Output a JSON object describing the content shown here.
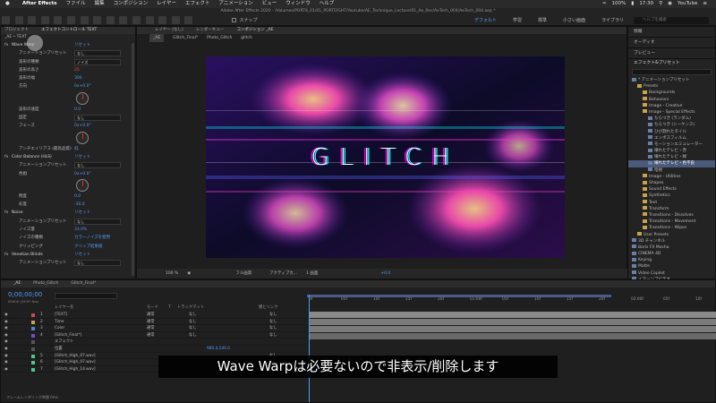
{
  "menubar": {
    "app_name": "After Effects",
    "items": [
      "ファイル",
      "編集",
      "コンポジション",
      "レイヤー",
      "エフェクト",
      "アニメーション",
      "ビュー",
      "ウィンドウ",
      "ヘルプ"
    ],
    "status": {
      "battery": "100%",
      "time": "17:30",
      "user": "YouTube"
    }
  },
  "titlebar": {
    "text": "Adobe After Effects 2020 - /Volumes/PORT8_01/01_PORTEIGHT/Youtube/AE_Technique_Lecture/01_Ae_Rec/AeTech_004/AeTech_004.aep *"
  },
  "toolbar": {
    "snap_label": "スナップ",
    "workspaces": [
      "デフォルト",
      "学習",
      "標準",
      "小さい画面",
      "ライブラリ"
    ],
    "active_workspace": "デフォルト",
    "help_search_placeholder": "ヘルプを検索"
  },
  "effect_controls": {
    "tabs": [
      "プロジェクト",
      "エフェクトコントロール TEXT",
      "レイヤー (なし)",
      "レンダーキュー",
      "コンポジション _AE"
    ],
    "breadcrumb": "_AE • TEXT",
    "rows": [
      {
        "label": "Wave Warp",
        "value": "リセット",
        "kind": "fx"
      },
      {
        "label": "アニメーションプリセット",
        "dropdown": "なし"
      },
      {
        "label": "波形の種類",
        "dropdown": "ノイズ"
      },
      {
        "label": "波形の高さ",
        "value": "25",
        "red": true
      },
      {
        "label": "波形の幅",
        "value": "300"
      },
      {
        "label": "方向",
        "value": "0x+0.0°"
      },
      {
        "label": "",
        "dial": true
      },
      {
        "label": "波形の速度",
        "value": "0.0"
      },
      {
        "label": "固定",
        "dropdown": "なし"
      },
      {
        "label": "フェーズ",
        "value": "0x+0.0°"
      },
      {
        "label": "",
        "dial": true
      },
      {
        "label": "アンチエイリアス (最高品質)",
        "value": "低"
      },
      {
        "label": "Color Balance (HLS)",
        "value": "リセット",
        "kind": "fx"
      },
      {
        "label": "アニメーションプリセット",
        "dropdown": "なし"
      },
      {
        "label": "色相",
        "value": "0x+0.0°"
      },
      {
        "label": "",
        "dial": true
      },
      {
        "label": "明度",
        "value": "0.0"
      },
      {
        "label": "彩度",
        "value": "-30.0"
      },
      {
        "label": "Noise",
        "value": "リセット",
        "kind": "fx"
      },
      {
        "label": "アニメーションプリセット",
        "dropdown": "なし"
      },
      {
        "label": "ノイズ量",
        "value": "33.0%"
      },
      {
        "label": "ノイズの種類",
        "value": "カラーノイズを使用"
      },
      {
        "label": "クリッピング",
        "value": "クリップ結果値"
      },
      {
        "label": "Venetian Blinds",
        "value": "リセット",
        "kind": "fx"
      },
      {
        "label": "アニメーションプリセット",
        "dropdown": "なし"
      }
    ]
  },
  "viewer": {
    "tabs": [
      "_AE",
      "Glitch_Final*",
      "Photo_Glitch",
      "glitch"
    ],
    "title": "GLITCH",
    "footer": {
      "zoom": "100 %",
      "quality": "フル画質",
      "camera": "アクティブカ...",
      "views": "1 画面",
      "offset": "+0.0"
    }
  },
  "right_panel": {
    "sections": [
      "情報",
      "オーディオ",
      "プレビュー",
      "エフェクト&プリセット"
    ],
    "search_placeholder": "",
    "tree": [
      {
        "label": "* アニメーションプリセット",
        "indent": 0
      },
      {
        "label": "Presets",
        "indent": 1,
        "folder": true
      },
      {
        "label": "Backgrounds",
        "indent": 2,
        "folder": true
      },
      {
        "label": "Behaviors",
        "indent": 2,
        "folder": true
      },
      {
        "label": "Image - Creative",
        "indent": 2,
        "folder": true
      },
      {
        "label": "Image - Special Effects",
        "indent": 2,
        "folder": true
      },
      {
        "label": "ちらつき (ランダム)",
        "indent": 3
      },
      {
        "label": "ちらつき (シーケンス)",
        "indent": 3
      },
      {
        "label": "ひび割れたタイル",
        "indent": 3
      },
      {
        "label": "エンボスフィルム",
        "indent": 3
      },
      {
        "label": "モーションエミュレーター",
        "indent": 3
      },
      {
        "label": "壊れたテレビ・赤",
        "indent": 3
      },
      {
        "label": "壊れたテレビ・緑",
        "indent": 3
      },
      {
        "label": "壊れたテレビ・色不良",
        "indent": 3,
        "selected": true
      },
      {
        "label": "暗視",
        "indent": 3
      },
      {
        "label": "Image - Utilities",
        "indent": 2,
        "folder": true
      },
      {
        "label": "Shapes",
        "indent": 2,
        "folder": true
      },
      {
        "label": "Sound Effects",
        "indent": 2,
        "folder": true
      },
      {
        "label": "Synthetics",
        "indent": 2,
        "folder": true
      },
      {
        "label": "Text",
        "indent": 2,
        "folder": true
      },
      {
        "label": "Transform",
        "indent": 2,
        "folder": true
      },
      {
        "label": "Transitions - Dissolves",
        "indent": 2,
        "folder": true
      },
      {
        "label": "Transitions - Movement",
        "indent": 2,
        "folder": true
      },
      {
        "label": "Transitions - Wipes",
        "indent": 2,
        "folder": true
      },
      {
        "label": "User Presets",
        "indent": 1,
        "folder": true
      },
      {
        "label": "3D チャンネル",
        "indent": 0
      },
      {
        "label": "Boris FX Mocha",
        "indent": 0
      },
      {
        "label": "CINEMA 4D",
        "indent": 0
      },
      {
        "label": "Keying",
        "indent": 0
      },
      {
        "label": "Matte",
        "indent": 0
      },
      {
        "label": "Video Copilot",
        "indent": 0
      },
      {
        "label": "イマーシブビデオ",
        "indent": 0
      }
    ]
  },
  "timeline": {
    "tabs": [
      "_AE",
      "Photo_Glitch",
      "Glitch_Final*"
    ],
    "timecode": "0;00;00;00",
    "timecode_sub": "00000 (29.97 fps)",
    "columns": [
      "レイヤー名",
      "モード",
      "T",
      "トラックマット",
      "親とリンク"
    ],
    "ruler": [
      "0f",
      "05f",
      "10f",
      "15f",
      "20f",
      "01:00f",
      "05f",
      "10f",
      "15f",
      "20f",
      "02:00f",
      "05f",
      "10f"
    ],
    "layers": [
      {
        "num": "1",
        "name": "[TEXT]",
        "mode": "通常",
        "matte": "なし",
        "parent": "なし"
      },
      {
        "num": "2",
        "name": "Time",
        "mode": "通常",
        "matte": "なし",
        "parent": "なし"
      },
      {
        "num": "3",
        "name": "Color",
        "mode": "通常",
        "matte": "なし",
        "parent": "なし"
      },
      {
        "num": "4",
        "name": "[Glitch_Final*]",
        "mode": "通常",
        "matte": "なし",
        "parent": "なし"
      },
      {
        "num": "",
        "name": "エフェクト",
        "mode": "",
        "matte": "",
        "parent": ""
      },
      {
        "num": "",
        "name": "位置",
        "mode": "",
        "matte": "",
        "parent": "",
        "value": "980.0,540.0"
      },
      {
        "num": "5",
        "name": "[Glitch_High_07.wav]",
        "mode": "",
        "matte": "",
        "parent": "なし"
      },
      {
        "num": "6",
        "name": "[Glitch_High_07.wav]",
        "mode": "",
        "matte": "",
        "parent": "なし"
      },
      {
        "num": "7",
        "name": "[Glitch_High_14.wav]",
        "mode": "",
        "matte": "",
        "parent": "なし"
      }
    ],
    "footer": "フレームレンダリング時間  0ms"
  },
  "caption": {
    "text": "Wave Warpは必要ないので非表示/削除します"
  }
}
